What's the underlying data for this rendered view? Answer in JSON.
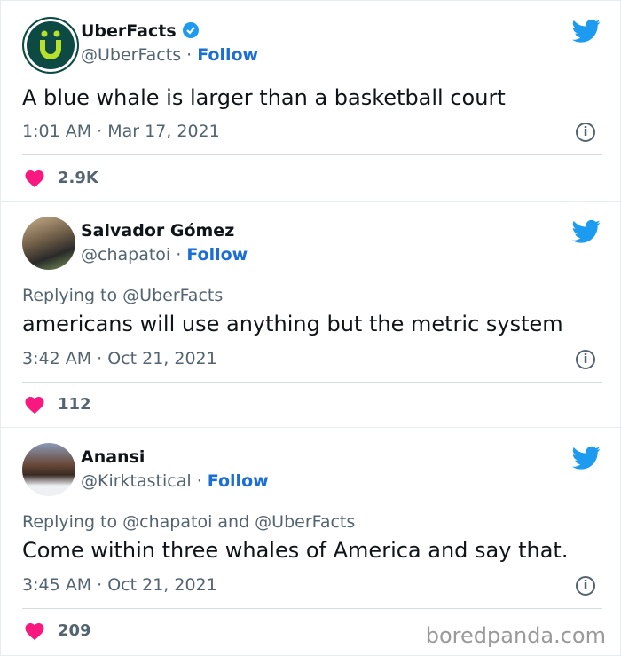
{
  "tweets": [
    {
      "name": "UberFacts",
      "verified": true,
      "handle": "@UberFacts",
      "follow": "Follow",
      "replying": "",
      "text": "A blue whale is larger than a basketball court",
      "time": "1:01 AM · Mar 17, 2021",
      "likes": "2.9K"
    },
    {
      "name": "Salvador Gómez",
      "verified": false,
      "handle": "@chapatoi",
      "follow": "Follow",
      "replying": "Replying to @UberFacts",
      "text": "americans will use anything but the metric system",
      "time": "3:42 AM · Oct 21, 2021",
      "likes": "112"
    },
    {
      "name": "Anansi",
      "verified": false,
      "handle": "@Kirktastical",
      "follow": "Follow",
      "replying": "Replying to @chapatoi and @UberFacts",
      "text": "Come within three whales of America and say that.",
      "time": "3:45 AM · Oct 21, 2021",
      "likes": "209"
    }
  ],
  "watermark": "boredpanda.com",
  "colors": {
    "follow": "#1b6ed6",
    "heart": "#f91880",
    "twitter": "#1d9bf0"
  }
}
